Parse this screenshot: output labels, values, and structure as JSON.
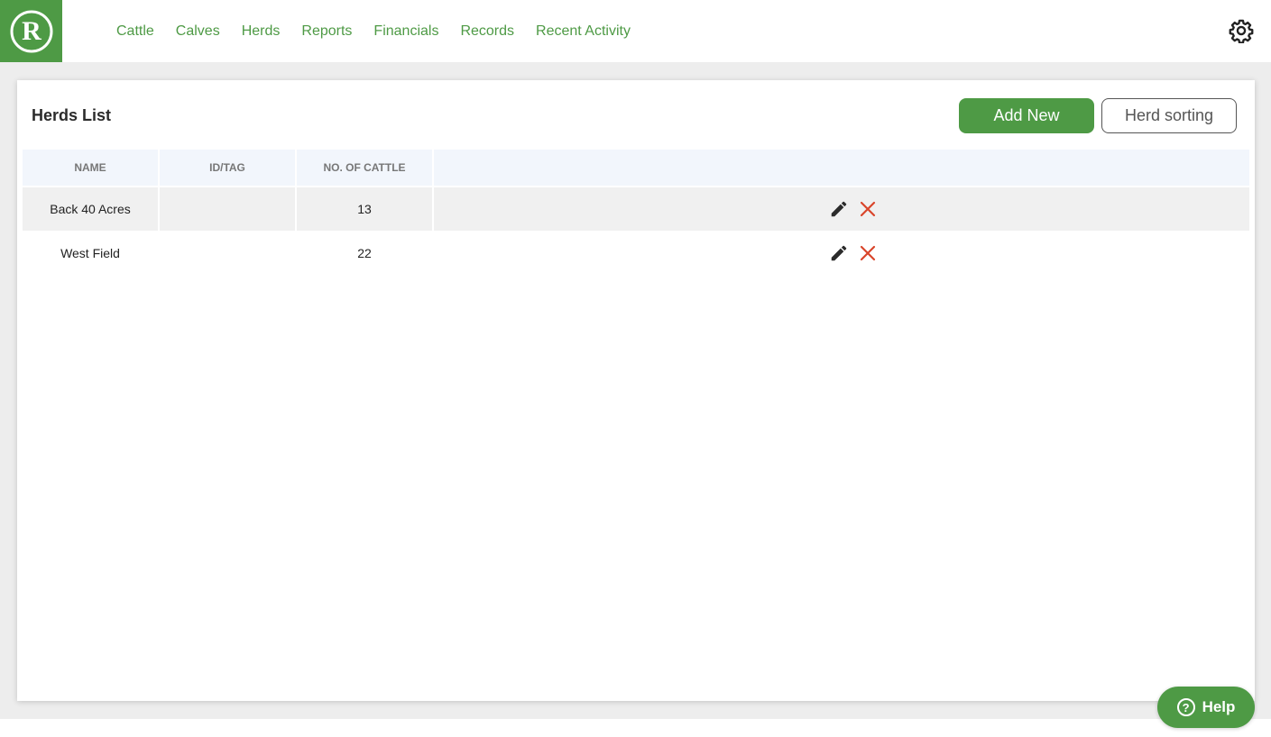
{
  "nav": {
    "items": [
      {
        "label": "Cattle"
      },
      {
        "label": "Calves"
      },
      {
        "label": "Herds"
      },
      {
        "label": "Reports"
      },
      {
        "label": "Financials"
      },
      {
        "label": "Records"
      },
      {
        "label": "Recent Activity"
      }
    ]
  },
  "panel": {
    "title": "Herds List",
    "add_new_label": "Add New",
    "herd_sorting_label": "Herd sorting"
  },
  "table": {
    "headers": [
      "NAME",
      "ID/TAG",
      "NO. OF CATTLE",
      ""
    ],
    "rows": [
      {
        "name": "Back 40 Acres",
        "id_tag": "",
        "cattle_count": "13"
      },
      {
        "name": "West Field",
        "id_tag": "",
        "cattle_count": "22"
      }
    ]
  },
  "help": {
    "label": "Help",
    "icon": "question-circle-icon"
  },
  "icons": {
    "logo": "r-logo",
    "settings": "gear-icon",
    "edit": "pencil-icon",
    "delete": "close-icon"
  },
  "colors": {
    "brand_green": "#4e9a45",
    "delete_red": "#d9452b",
    "header_bg": "#f2f6fc"
  }
}
